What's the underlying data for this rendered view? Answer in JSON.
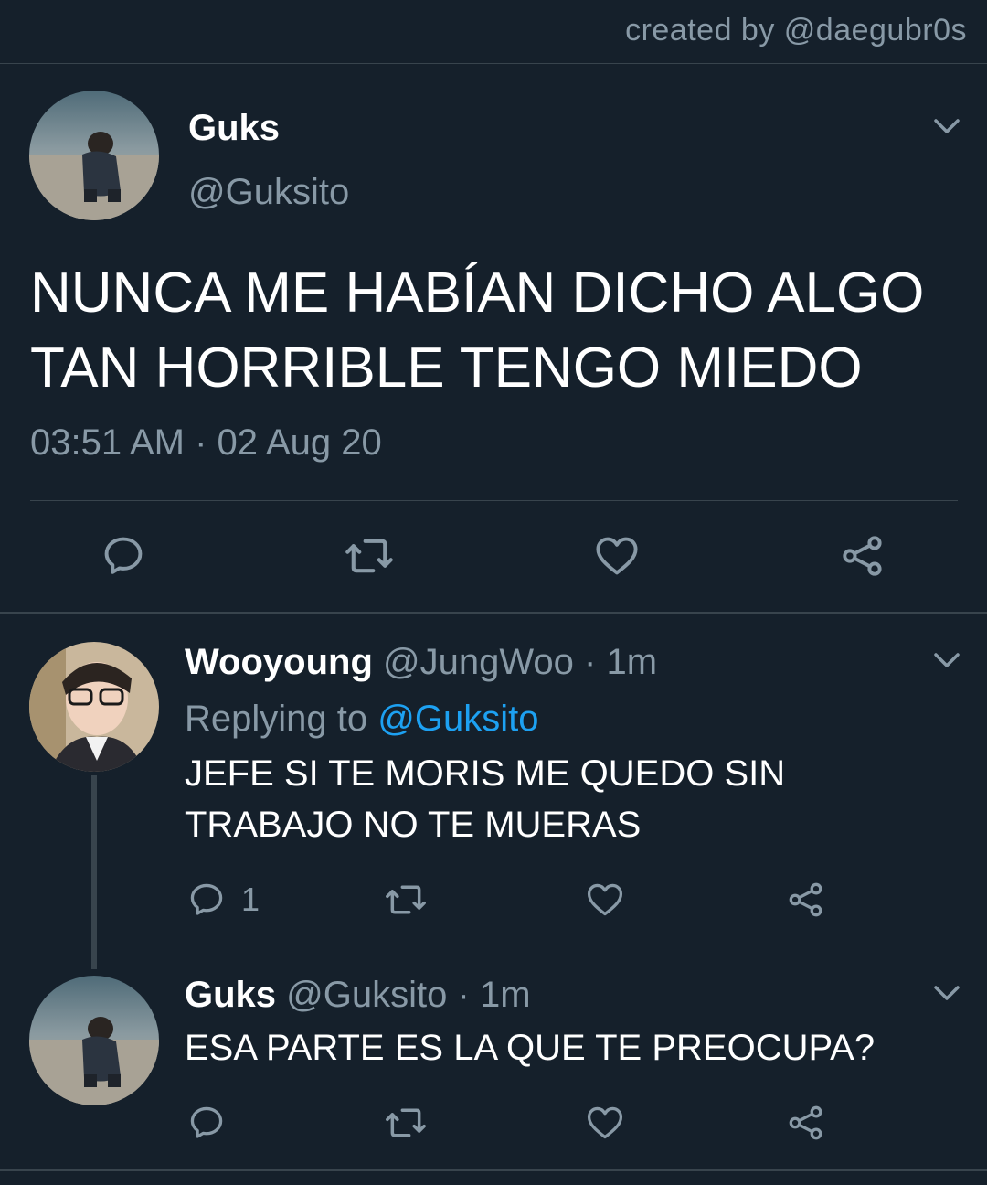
{
  "credit": "created by @daegubr0s",
  "main_tweet": {
    "name": "Guks",
    "handle": "@Guksito",
    "text": "NUNCA ME HABÍAN DICHO ALGO TAN HORRIBLE TENGO MIEDO",
    "timestamp": "03:51 AM · 02 Aug 20"
  },
  "replies": [
    {
      "name": "Wooyoung",
      "handle": "@JungWoo",
      "time": "· 1m",
      "replying_label": "Replying to",
      "replying_to": "@Guksito",
      "text": "JEFE SI TE MORIS ME QUEDO SIN TRABAJO NO TE MUERAS",
      "reply_count": "1"
    },
    {
      "name": "Guks",
      "handle": "@Guksito",
      "time": "· 1m",
      "text": "ESA PARTE ES LA QUE TE PREOCUPA?"
    }
  ],
  "icons": [
    "chevron-down-icon",
    "reply-icon",
    "retweet-icon",
    "like-icon",
    "share-icon"
  ],
  "colors": {
    "background": "#15202b",
    "secondary_text": "#8899a6",
    "link": "#1da1f2",
    "divider": "#38444d"
  }
}
